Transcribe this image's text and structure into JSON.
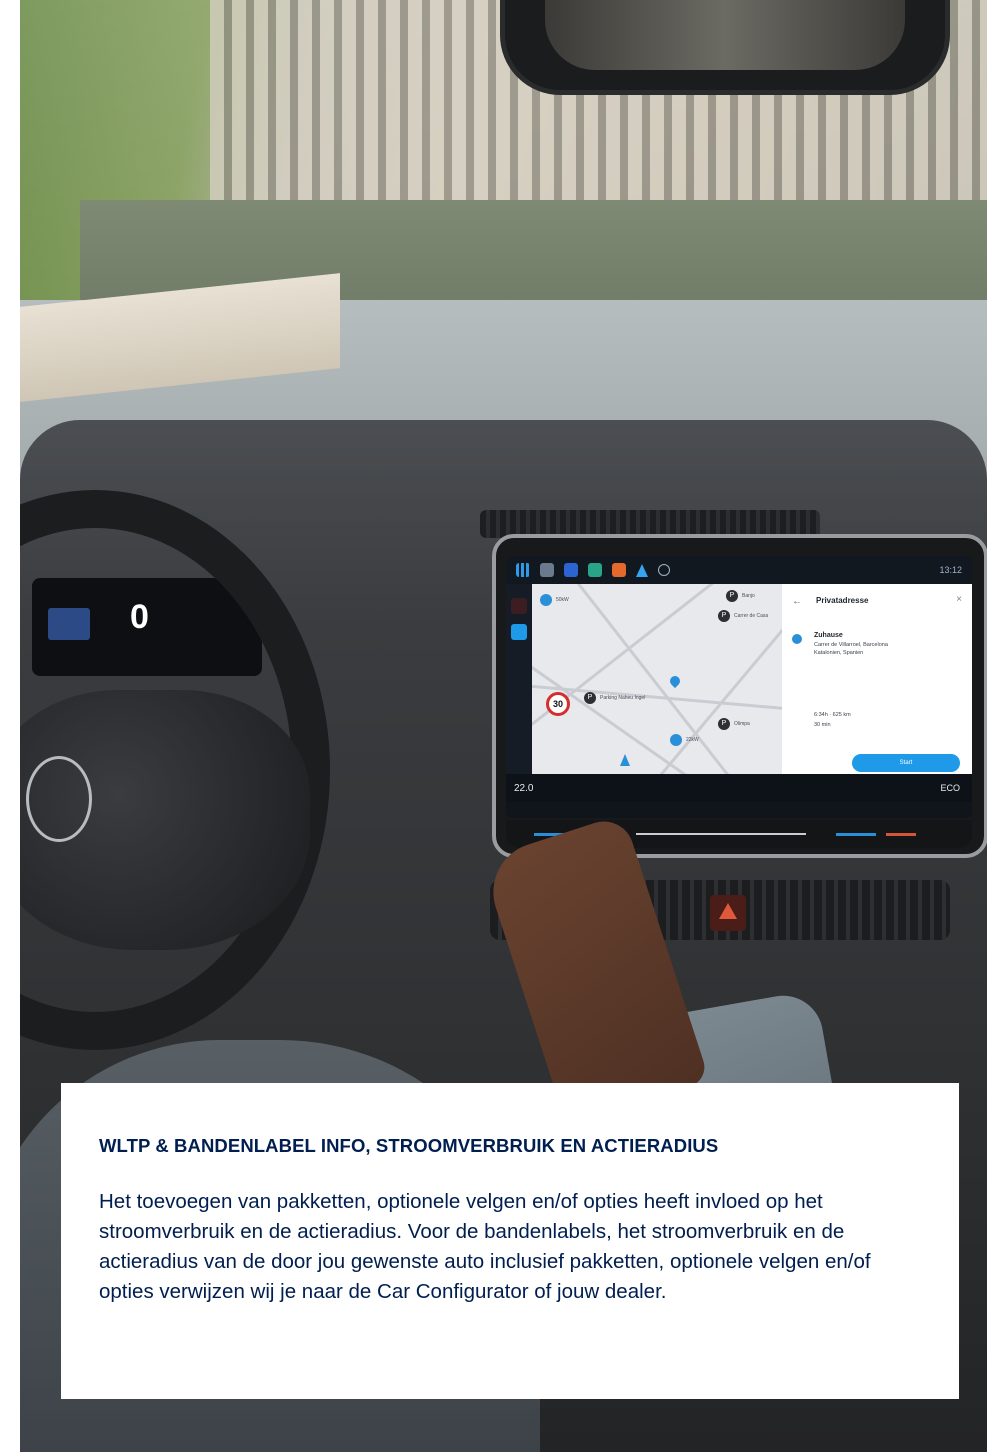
{
  "colors": {
    "title": "#001e50",
    "body": "#001e50",
    "card_background": "#ffffff",
    "accent": "#1e9ae8"
  },
  "photo": {
    "cluster": {
      "speed": "0"
    },
    "screen": {
      "status_time": "13:12",
      "side_rail_icons": [
        "search-icon",
        "message-icon",
        "settings-icon"
      ],
      "app_icons": [
        "apps-grid-icon",
        "car-icon",
        "parking-icon",
        "home-icon",
        "food-icon",
        "navigation-icon",
        "plus-icon"
      ],
      "map": {
        "speed_limit": "30",
        "poi_labels": [
          "50kW",
          "Banjo",
          "Carrer de Casa",
          "Parking Naheu Ingel",
          "Olimpa",
          "22kW"
        ]
      },
      "panel": {
        "back_glyph": "←",
        "title": "Privatadresse",
        "close_glyph": "×",
        "destination_name": "Zuhause",
        "destination_line1": "Carrer de Villarroel, Barcelona",
        "destination_line2": "Katalonien, Spanien",
        "route_range": "6:34h · 625 km",
        "route_time": "30 min",
        "start_label": "Start"
      },
      "bottom_bar": {
        "temperature": "22.0",
        "mode": "ECO"
      }
    }
  },
  "info_card": {
    "title": "WLTP & BANDENLABEL INFO, STROOMVERBRUIK EN ACTIERADIUS",
    "body": "Het toevoegen van pakketten, optionele velgen en/of opties heeft invloed op het stroomverbruik en de actieradius. Voor de bandenlabels, het stroomverbruik en de actieradius van de door jou gewenste auto inclusief pakketten, optionele velgen en/of opties verwijzen wij je naar de Car Configurator of jouw dealer."
  }
}
